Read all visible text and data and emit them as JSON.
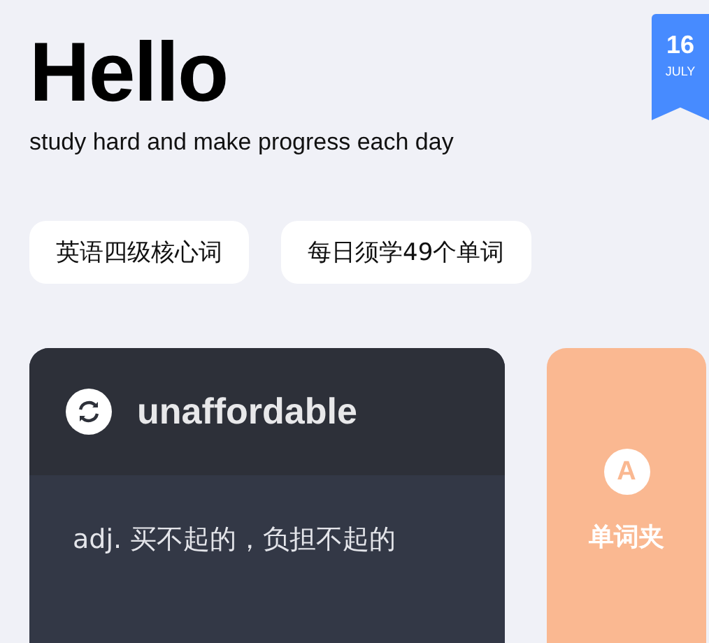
{
  "header": {
    "title": "Hello",
    "subtitle": "study hard and make progress each day"
  },
  "date_badge": {
    "day": "16",
    "month": "JULY"
  },
  "tags": [
    "英语四级核心词",
    "每日须学49个单词"
  ],
  "word_card": {
    "word": "unaffordable",
    "definition": "adj. 买不起的，负担不起的"
  },
  "folder_card": {
    "icon_letter": "A",
    "label": "单词夹"
  }
}
